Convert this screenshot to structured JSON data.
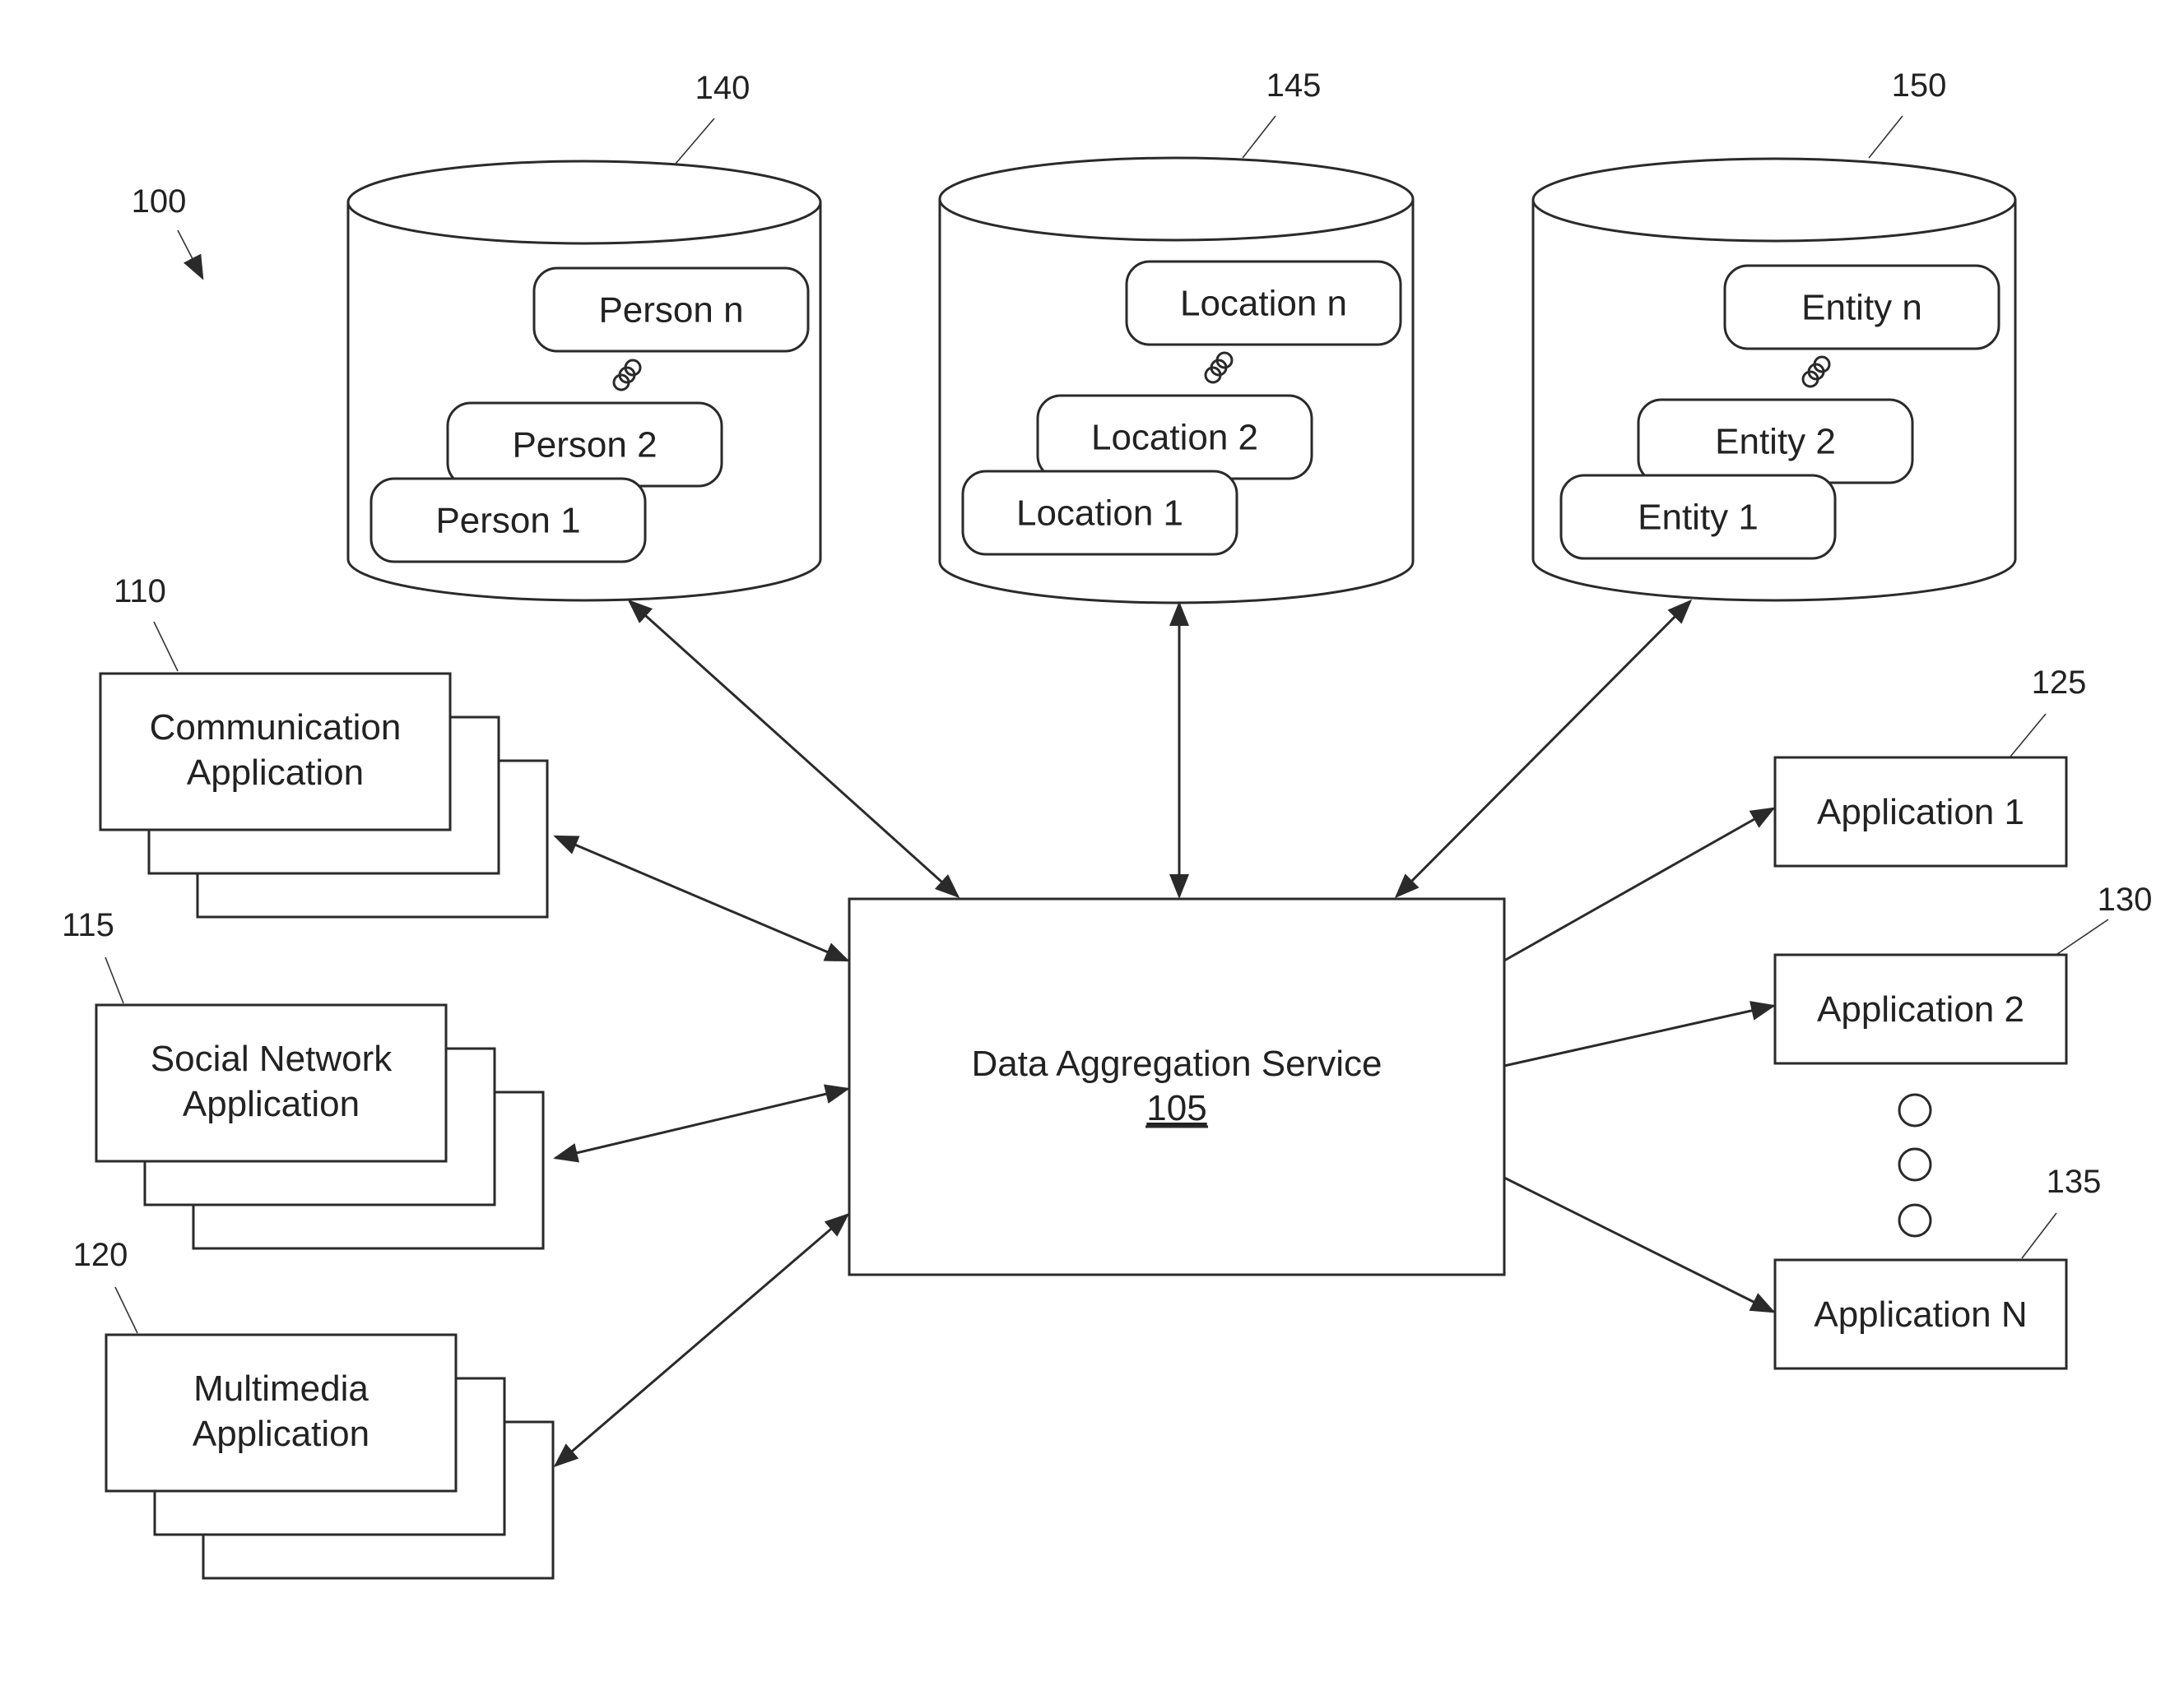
{
  "figure": {
    "ref": "100"
  },
  "datastores": [
    {
      "ref": "140",
      "items": [
        "Person n",
        "Person 2",
        "Person 1"
      ]
    },
    {
      "ref": "145",
      "items": [
        "Location n",
        "Location 2",
        "Location 1"
      ]
    },
    {
      "ref": "150",
      "items": [
        "Entity n",
        "Entity 2",
        "Entity 1"
      ]
    }
  ],
  "sources": [
    {
      "ref": "110",
      "line1": "Communication",
      "line2": "Application"
    },
    {
      "ref": "115",
      "line1": "Social Network",
      "line2": "Application"
    },
    {
      "ref": "120",
      "line1": "Multimedia",
      "line2": "Application"
    }
  ],
  "service": {
    "name": "Data Aggregation Service",
    "ref": "105"
  },
  "consumers": [
    {
      "ref": "125",
      "label": "Application 1"
    },
    {
      "ref": "130",
      "label": "Application 2"
    },
    {
      "ref": "135",
      "label": "Application N"
    }
  ],
  "connections": [
    {
      "from": "140",
      "to": "105",
      "direction": "bidirectional"
    },
    {
      "from": "145",
      "to": "105",
      "direction": "bidirectional"
    },
    {
      "from": "150",
      "to": "105",
      "direction": "bidirectional"
    },
    {
      "from": "110",
      "to": "105",
      "direction": "bidirectional"
    },
    {
      "from": "115",
      "to": "105",
      "direction": "bidirectional"
    },
    {
      "from": "120",
      "to": "105",
      "direction": "bidirectional"
    },
    {
      "from": "105",
      "to": "125",
      "direction": "forward"
    },
    {
      "from": "105",
      "to": "130",
      "direction": "forward"
    },
    {
      "from": "105",
      "to": "135",
      "direction": "forward"
    }
  ],
  "colors": {
    "ink": "#2a2a2a",
    "background": "#ffffff"
  }
}
